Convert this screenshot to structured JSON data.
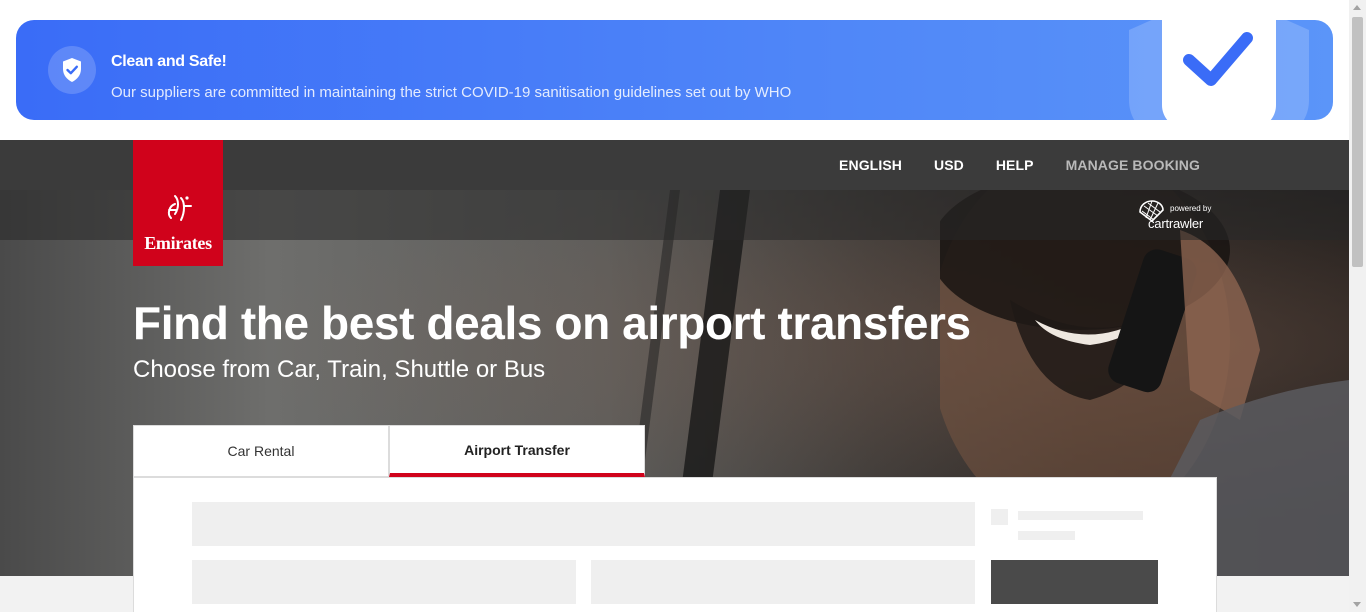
{
  "banner": {
    "title": "Clean and Safe!",
    "text": "Our suppliers are committed in maintaining the strict COVID-19 sanitisation guidelines set out by WHO",
    "icon": "shield-check-icon",
    "color": "#3a6cf7"
  },
  "header": {
    "nav": {
      "language": "ENGLISH",
      "currency": "USD",
      "help": "HELP",
      "manage_booking": "MANAGE BOOKING"
    },
    "logo_text": "Emirates",
    "powered_small": "powered by",
    "powered_name": "cartrawler",
    "brand_color": "#d0021b"
  },
  "hero": {
    "title": "Find the best deals on airport transfers",
    "subtitle": "Choose from Car, Train, Shuttle or Bus"
  },
  "tabs": [
    {
      "label": "Car Rental",
      "active": false
    },
    {
      "label": "Airport Transfer",
      "active": true
    }
  ]
}
